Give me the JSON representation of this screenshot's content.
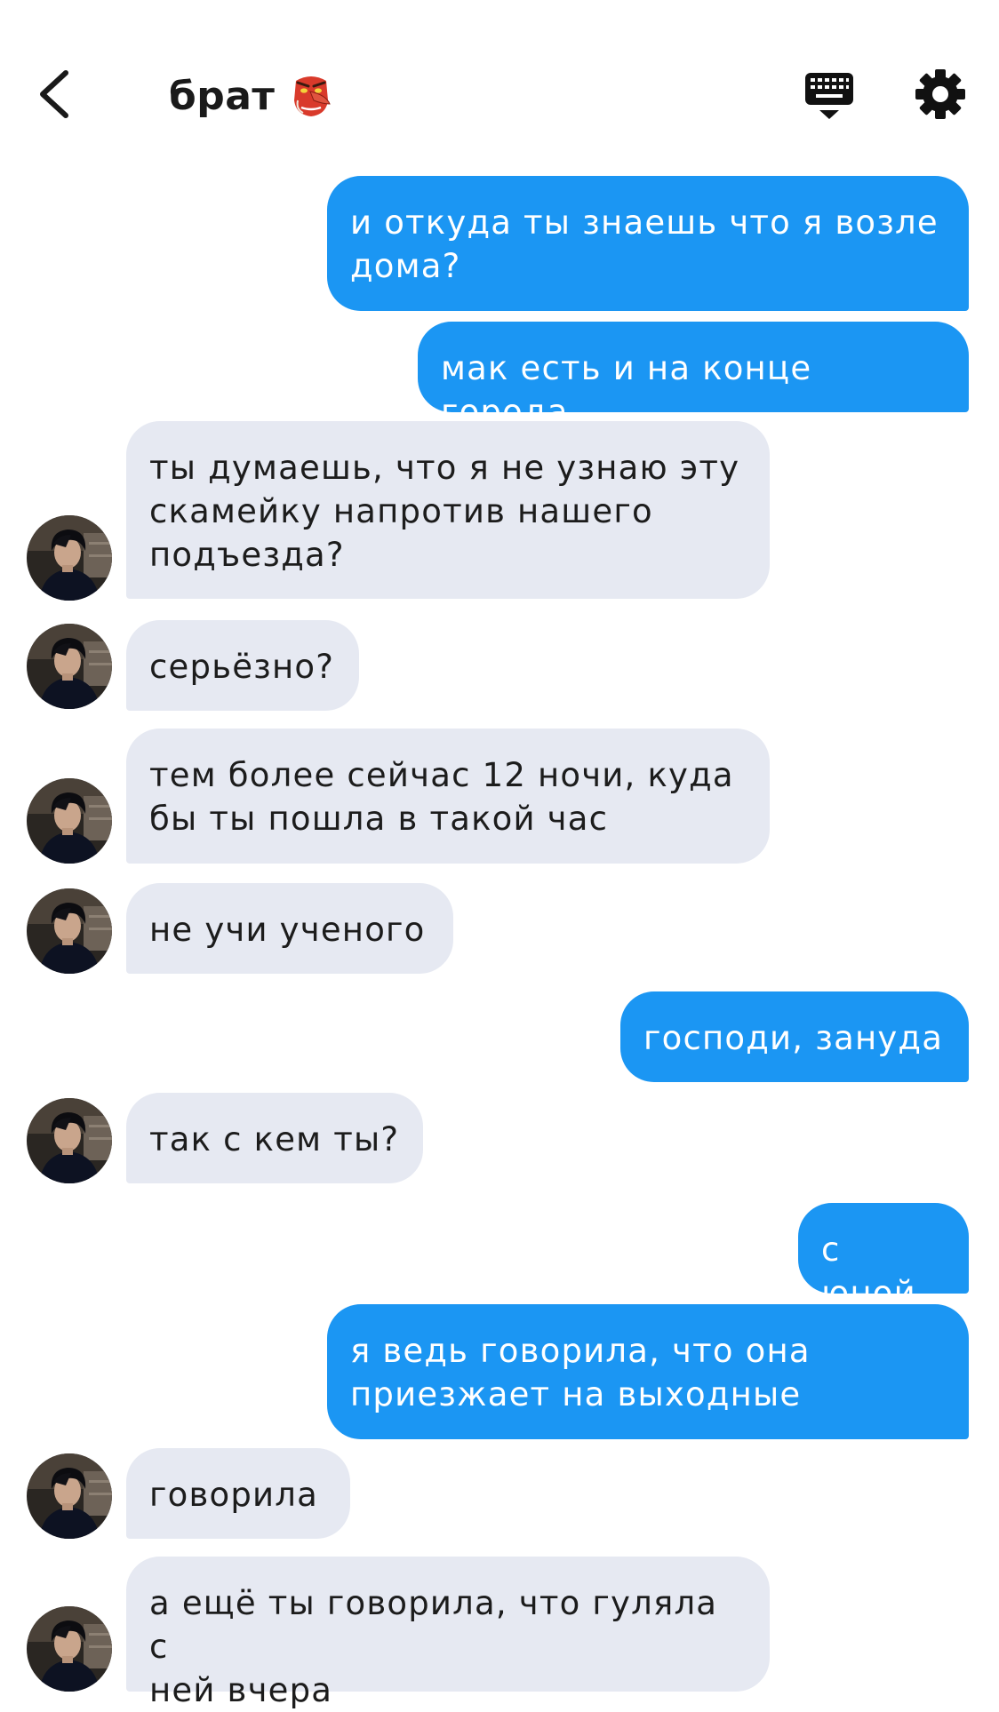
{
  "header": {
    "title": "брат",
    "back_icon": "chevron-left-icon",
    "emoji_icon": "tengu-mask-emoji",
    "keyboard_icon": "keyboard-icon",
    "settings_icon": "gear-icon"
  },
  "colors": {
    "outgoing_bubble": "#1b96f3",
    "incoming_bubble": "#e6e9f2",
    "background": "#ffffff"
  },
  "messages": [
    {
      "dir": "out",
      "text": "и откуда ты знаешь что я возле\nдома?"
    },
    {
      "dir": "out",
      "text": "мак есть и на конце города"
    },
    {
      "dir": "in",
      "text": "ты думаешь, что я не узнаю эту\nскамейку напротив нашего\nподъезда?"
    },
    {
      "dir": "in",
      "text": "серьёзно?"
    },
    {
      "dir": "in",
      "text": "тем более сейчас 12 ночи, куда\nбы ты пошла в такой час"
    },
    {
      "dir": "in",
      "text": "не учи ученого"
    },
    {
      "dir": "out",
      "text": "господи, зануда"
    },
    {
      "dir": "in",
      "text": "так с кем ты?"
    },
    {
      "dir": "out",
      "text": "с юной"
    },
    {
      "dir": "out",
      "text": "я ведь говорила, что она\nприезжает на выходные"
    },
    {
      "dir": "in",
      "text": "говорила"
    },
    {
      "dir": "in",
      "text": "а ещё ты говорила, что гуляла с\nней вчера"
    }
  ]
}
